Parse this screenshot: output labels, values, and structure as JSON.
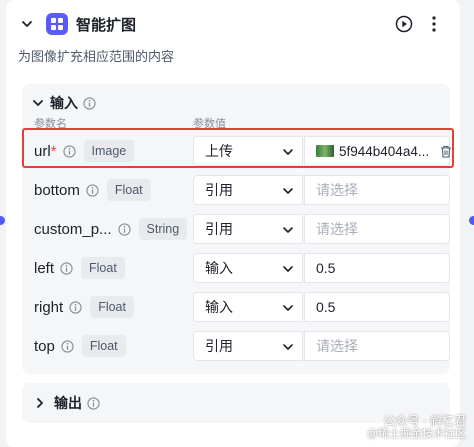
{
  "node": {
    "title": "智能扩图",
    "description": "为图像扩充相应范围的内容",
    "accent_color": "#5b5bf7",
    "icons": [
      "chevron-down-icon",
      "node-type-icon",
      "run-icon",
      "more-icon"
    ]
  },
  "input_section": {
    "title": "输入",
    "col_param_name": "参数名",
    "col_param_value": "参数值",
    "rows": [
      {
        "name": "url",
        "required_mark": "*",
        "type": "Image",
        "source": "上传",
        "value": "5f944b404a4...",
        "placeholder": ""
      },
      {
        "name": "bottom",
        "required_mark": "",
        "type": "Float",
        "source": "引用",
        "value": "",
        "placeholder": "请选择"
      },
      {
        "name": "custom_p...",
        "required_mark": "",
        "type": "String",
        "source": "引用",
        "value": "",
        "placeholder": "请选择"
      },
      {
        "name": "left",
        "required_mark": "",
        "type": "Float",
        "source": "输入",
        "value": "0.5",
        "placeholder": ""
      },
      {
        "name": "right",
        "required_mark": "",
        "type": "Float",
        "source": "输入",
        "value": "0.5",
        "placeholder": ""
      },
      {
        "name": "top",
        "required_mark": "",
        "type": "Float",
        "source": "引用",
        "value": "",
        "placeholder": "请选择"
      }
    ]
  },
  "output_section": {
    "title": "输出"
  },
  "watermark": {
    "line1": "公众号 · 斜杠君",
    "line2": "@稀土掘金技术社区"
  },
  "highlight_color": "#e2403a"
}
